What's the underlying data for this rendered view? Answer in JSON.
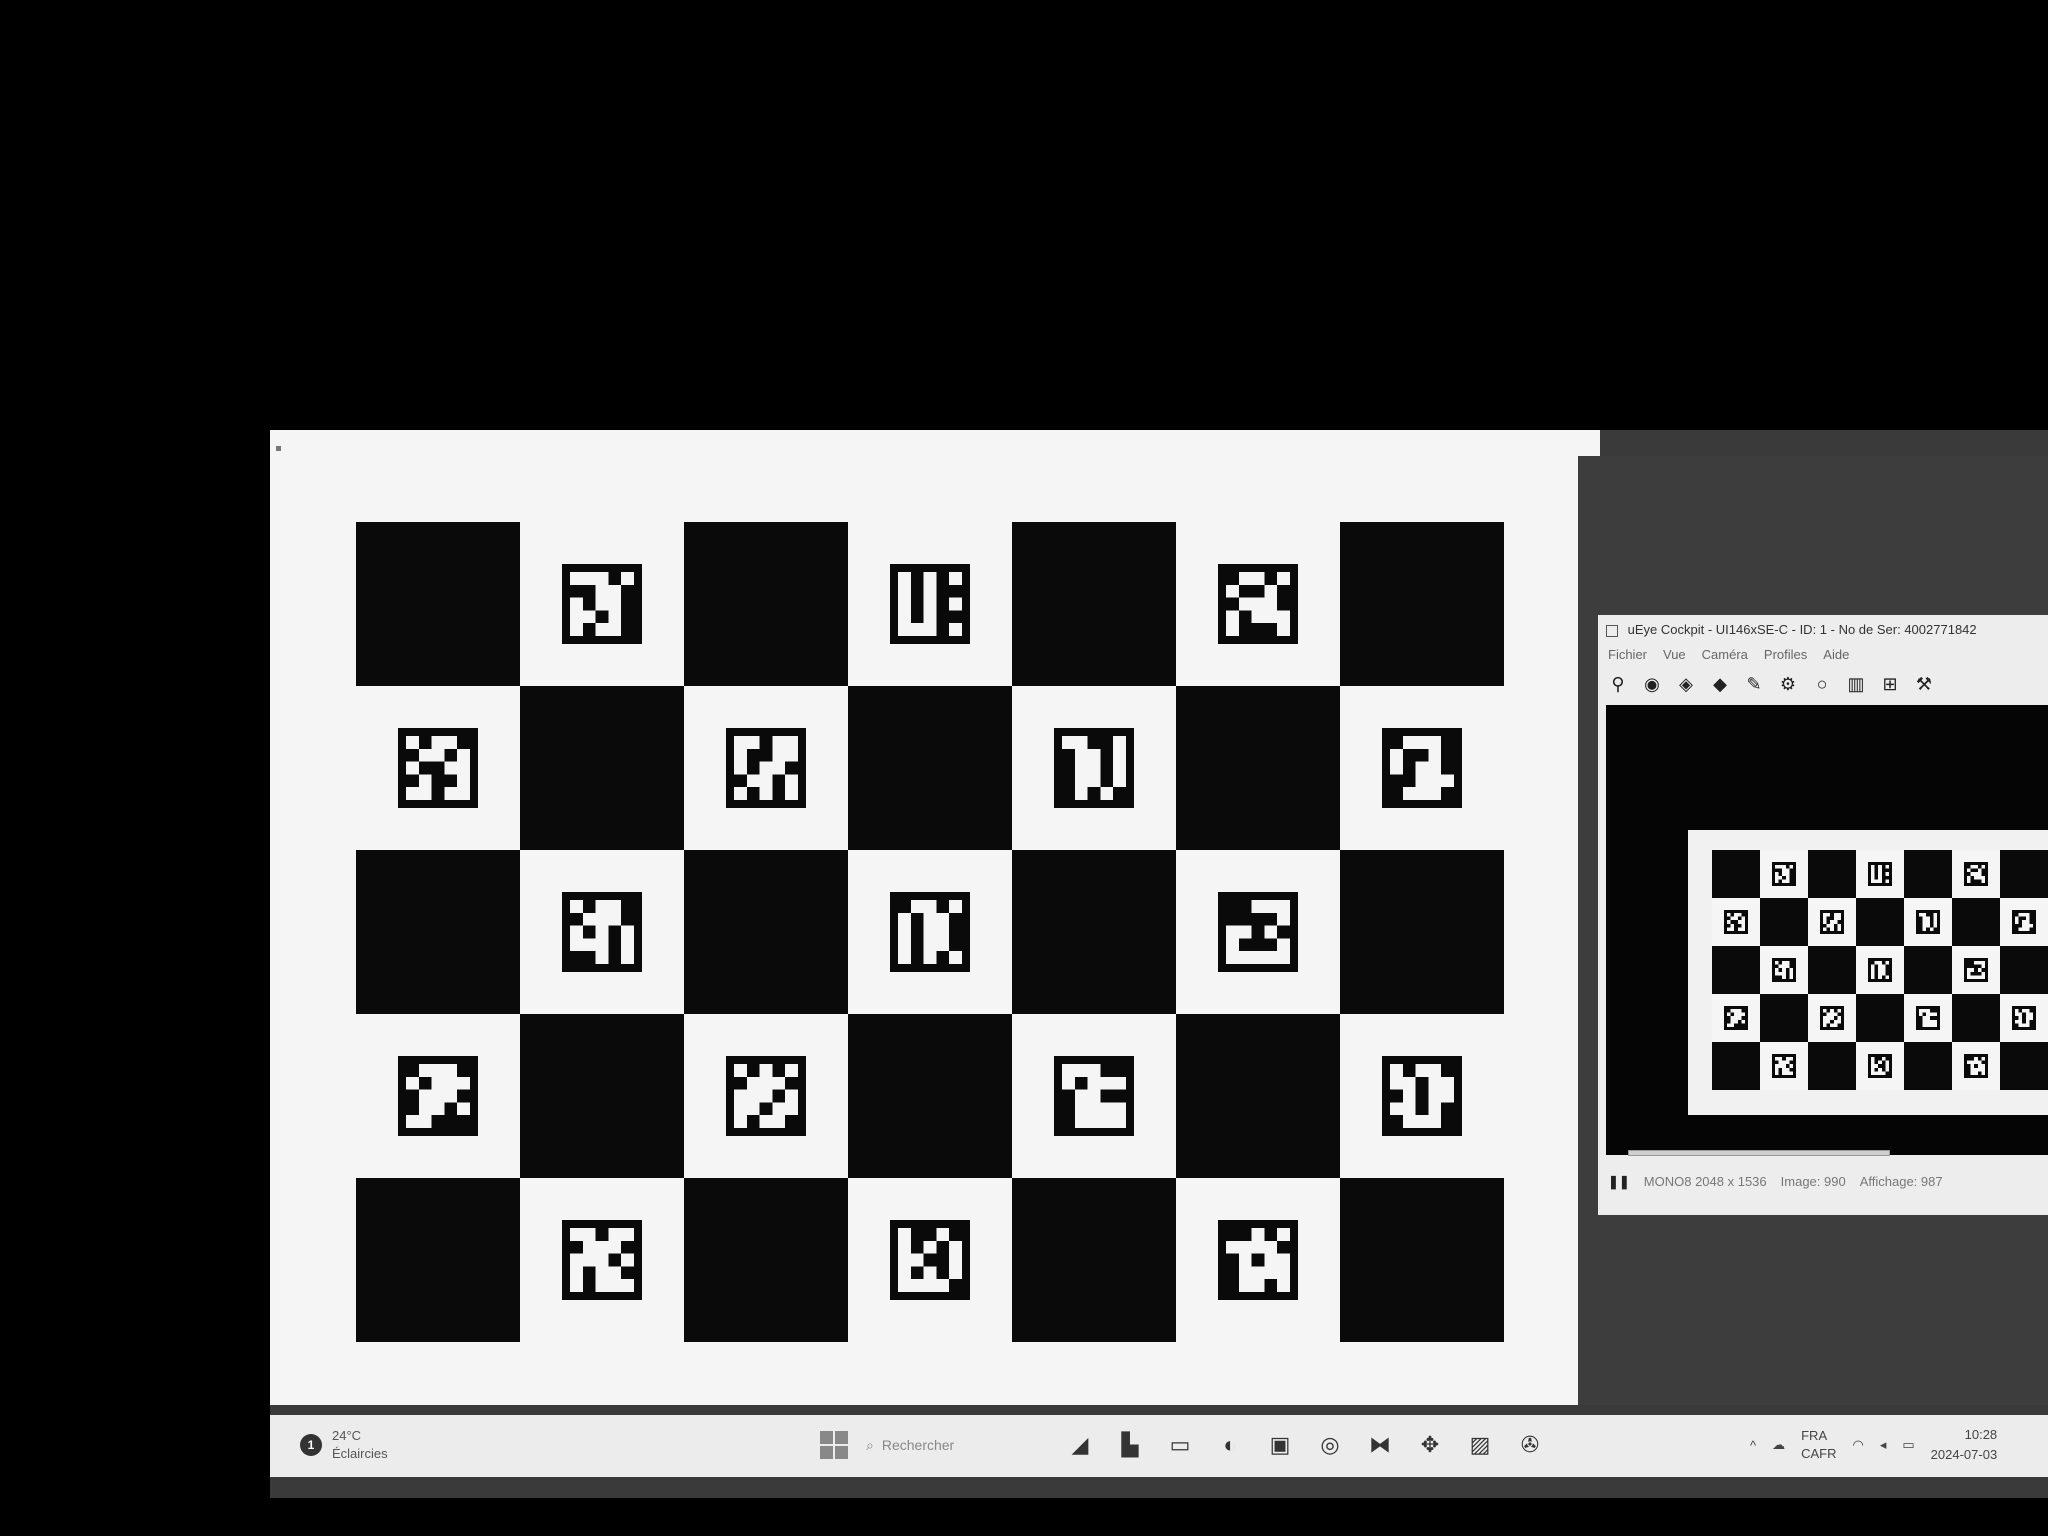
{
  "cockpit": {
    "title": "uEye Cockpit - UI146xSE-C - ID: 1 - No de Ser: 4002771842",
    "menu": [
      "Fichier",
      "Vue",
      "Caméra",
      "Profiles",
      "Aide"
    ],
    "status_format": "MONO8 2048 x 1536",
    "status_image": "Image: 990",
    "status_display": "Affichage: 987",
    "pause_icon": "pause-icon"
  },
  "taskbar": {
    "weather_temp": "24°C",
    "weather_desc": "Éclaircies",
    "weather_badge": "1",
    "search_placeholder": "Rechercher",
    "lang_primary": "FRA",
    "lang_secondary": "CAFR",
    "time": "10:28",
    "date": "2024-07-03"
  },
  "board": {
    "rows": 5,
    "cols": 7,
    "markers": [
      {
        "row": 0,
        "col": 1,
        "bits": "1110100110101101101010110"
      },
      {
        "row": 0,
        "col": 3,
        "bits": "1010110100101011010011101"
      },
      {
        "row": 0,
        "col": 5,
        "bits": "0110110010011101011110001"
      },
      {
        "row": 1,
        "col": 0,
        "bits": "1011001101100110100111011"
      },
      {
        "row": 1,
        "col": 2,
        "bits": "1101110011101100110110101"
      },
      {
        "row": 1,
        "col": 4,
        "bits": "1100101101011010110101010"
      },
      {
        "row": 1,
        "col": 6,
        "bits": "0111010010101100011101110"
      },
      {
        "row": 2,
        "col": 1,
        "bits": "1011001110101011110100101"
      },
      {
        "row": 2,
        "col": 3,
        "bits": "0110110110101101011010101"
      },
      {
        "row": 2,
        "col": 5,
        "bits": "0011100001110101000111111"
      },
      {
        "row": 3,
        "col": 0,
        "bits": "0111010111011100110111000"
      },
      {
        "row": 3,
        "col": 2,
        "bits": "1010101110111011101110110"
      },
      {
        "row": 3,
        "col": 4,
        "bits": "1110010111011000111101111"
      },
      {
        "row": 3,
        "col": 6,
        "bits": "1011011011010111101001110"
      },
      {
        "row": 4,
        "col": 1,
        "bits": "1101101110111011011010111"
      },
      {
        "row": 4,
        "col": 3,
        "bits": "1001010101110011010111110"
      },
      {
        "row": 4,
        "col": 5,
        "bits": "0010111110010110111101101"
      }
    ]
  },
  "colors": {
    "dark": "#0a0a0a",
    "light": "#f5f5f5"
  }
}
